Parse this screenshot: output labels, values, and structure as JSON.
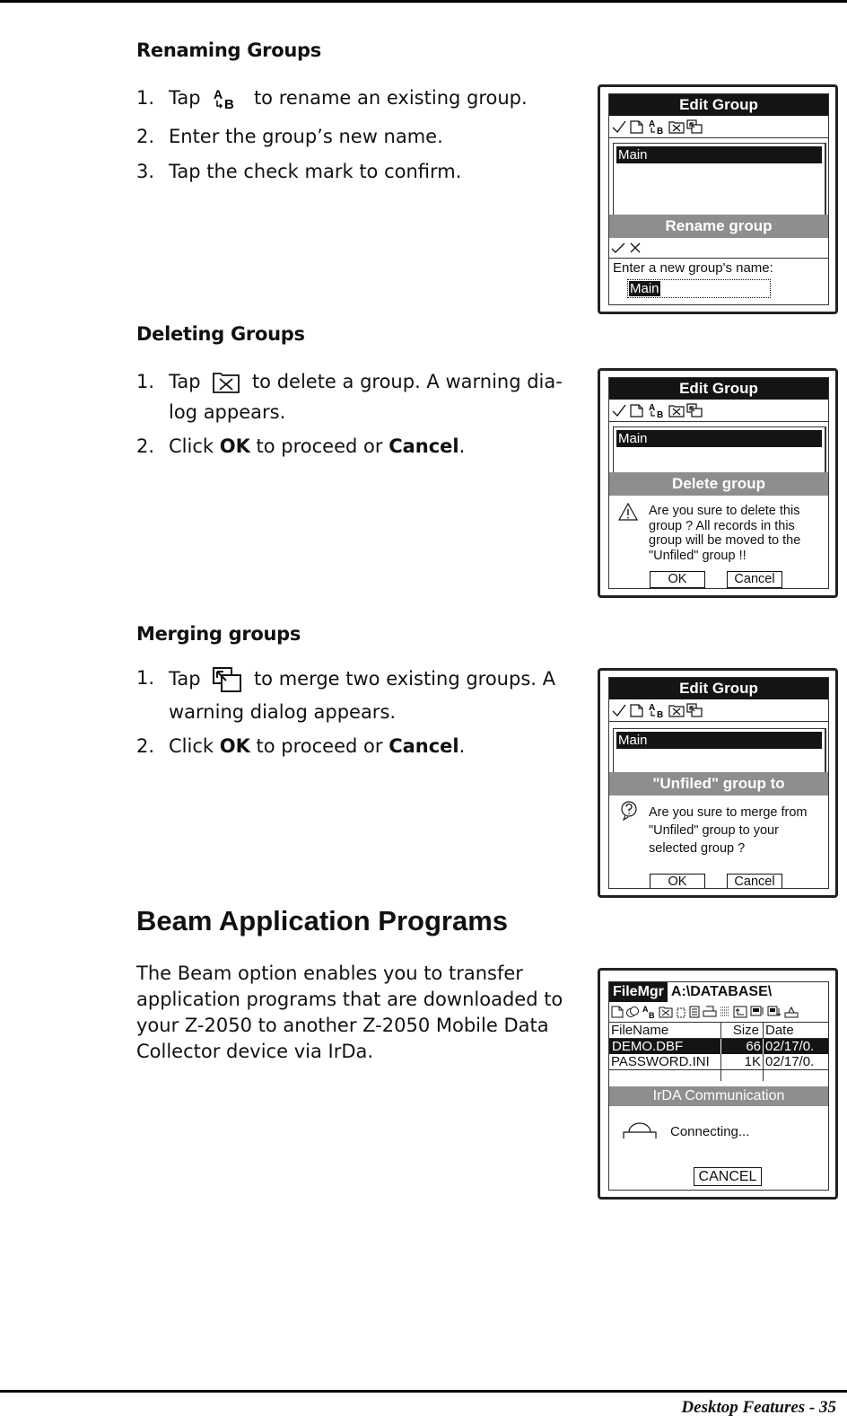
{
  "footer": {
    "text": "Desktop Features - 35"
  },
  "renaming": {
    "heading": "Renaming Groups",
    "steps": [
      {
        "num": "1.",
        "before": "Tap",
        "after": "to rename an existing group.",
        "icon": "rename-icon"
      },
      {
        "num": "2.",
        "text": "Enter the group’s new name."
      },
      {
        "num": "3.",
        "text": "Tap the check mark to confirm."
      }
    ],
    "screen": {
      "title": "Edit Group",
      "toolbar_icons": [
        "check-icon",
        "new-icon",
        "rename-icon",
        "delete-icon",
        "merge-icon"
      ],
      "selected_group": "Main",
      "dialog_title": "Rename group",
      "dialog_icons": [
        "check-icon",
        "close-icon"
      ],
      "prompt": "Enter a new group's name:",
      "input_value": "Main"
    }
  },
  "deleting": {
    "heading": "Deleting Groups",
    "steps": [
      {
        "num": "1.",
        "before": "Tap",
        "after": "to delete a group. A warning dia-log appears.",
        "icon": "delete-icon"
      },
      {
        "num": "2.",
        "pre": "Click ",
        "b1": "OK",
        "mid": " to proceed or ",
        "b2": "Cancel",
        "end": "."
      }
    ],
    "screen": {
      "title": "Edit Group",
      "selected_group": "Main",
      "dialog_title": "Delete group",
      "dialog_icon": "warning-icon",
      "message_lines": [
        "Are you sure to delete this",
        "group ? All records in this",
        "group will be moved to the",
        "\"Unfiled\" group !!"
      ],
      "ok_label": "OK",
      "cancel_label": "Cancel"
    }
  },
  "merging": {
    "heading": "Merging groups",
    "steps": [
      {
        "num": "1.",
        "before": "Tap",
        "after": "to merge two existing groups. A warning dialog appears.",
        "icon": "merge-icon"
      },
      {
        "num": "2.",
        "pre": "Click ",
        "b1": "OK",
        "mid": " to proceed or ",
        "b2": "Cancel",
        "end": "."
      }
    ],
    "screen": {
      "title": "Edit Group",
      "selected_group": "Main",
      "dialog_title": "\"Unfiled\" group to",
      "dialog_icon": "question-icon",
      "message_lines": [
        "Are you sure to merge from",
        "\"Unfiled\" group to your",
        "selected group ?"
      ],
      "ok_label": "OK",
      "cancel_label": "Cancel"
    }
  },
  "beam": {
    "heading": "Beam Application Programs",
    "paragraph": "The Beam option enables you to transfer application programs that are downloaded to your Z-2050 to another Z-2050 Mobile Data Collector device via IrDa.",
    "screen": {
      "app_label": "FileMgr",
      "path": "A:\\DATABASE\\",
      "columns": [
        "FileName",
        "Size",
        "Date"
      ],
      "rows": [
        {
          "name": "DEMO.DBF",
          "size": "66",
          "date": "02/17/0.",
          "selected": true
        },
        {
          "name": "PASSWORD.INI",
          "size": "1K",
          "date": "02/17/0.",
          "selected": false
        }
      ],
      "dialog_title": "IrDA Communication",
      "status": "Connecting...",
      "cancel_label": "CANCEL"
    }
  }
}
